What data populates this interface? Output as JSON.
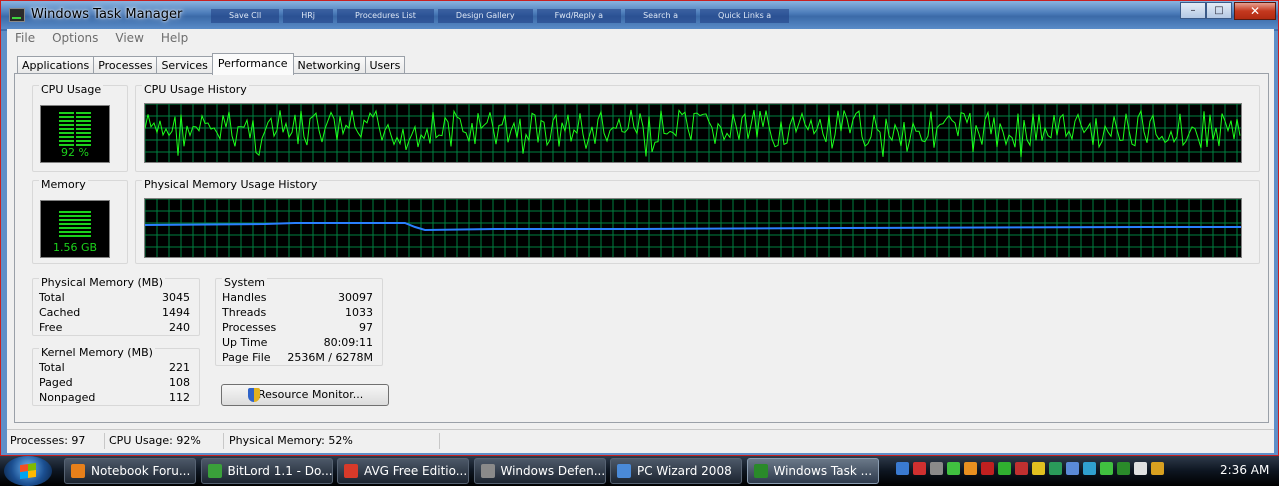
{
  "window": {
    "title": "Windows Task Manager",
    "background_tabs": [
      "Save Cll",
      "HRj",
      "Procedures List",
      "Design Gallery",
      "Fwd/Reply a",
      "Search a",
      "Quick Links a"
    ]
  },
  "menu": [
    "File",
    "Options",
    "View",
    "Help"
  ],
  "tabs": [
    {
      "label": "Applications"
    },
    {
      "label": "Processes"
    },
    {
      "label": "Services"
    },
    {
      "label": "Performance",
      "active": true
    },
    {
      "label": "Networking"
    },
    {
      "label": "Users"
    }
  ],
  "cpu_usage": {
    "label": "CPU Usage",
    "value": "92 %"
  },
  "cpu_history": {
    "label": "CPU Usage History"
  },
  "memory": {
    "label": "Memory",
    "value": "1.56 GB"
  },
  "memory_history": {
    "label": "Physical Memory Usage History"
  },
  "physical_memory": {
    "label": "Physical Memory (MB)",
    "rows": [
      {
        "k": "Total",
        "v": "3045"
      },
      {
        "k": "Cached",
        "v": "1494"
      },
      {
        "k": "Free",
        "v": "240"
      }
    ]
  },
  "kernel_memory": {
    "label": "Kernel Memory (MB)",
    "rows": [
      {
        "k": "Total",
        "v": "221"
      },
      {
        "k": "Paged",
        "v": "108"
      },
      {
        "k": "Nonpaged",
        "v": "112"
      }
    ]
  },
  "system": {
    "label": "System",
    "rows": [
      {
        "k": "Handles",
        "v": "30097"
      },
      {
        "k": "Threads",
        "v": "1033"
      },
      {
        "k": "Processes",
        "v": "97"
      },
      {
        "k": "Up Time",
        "v": "80:09:11"
      },
      {
        "k": "Page File",
        "v": "2536M / 6278M"
      }
    ]
  },
  "resource_monitor_button": "Resource Monitor...",
  "statusbar": {
    "processes": "Processes: 97",
    "cpu": "CPU Usage: 92%",
    "memory": "Physical Memory: 52%"
  },
  "taskbar": {
    "items": [
      {
        "label": "Notebook Foru...",
        "icon": "firefox-icon",
        "color": "#e8801a"
      },
      {
        "label": "BitLord 1.1 - Do...",
        "icon": "bitlord-icon",
        "color": "#3aa03a"
      },
      {
        "label": "AVG Free Editio...",
        "icon": "avg-icon",
        "color": "#d83a2a"
      },
      {
        "label": "Windows Defen...",
        "icon": "defender-icon",
        "color": "#8a8a8a"
      },
      {
        "label": "PC Wizard 2008",
        "icon": "pcwizard-icon",
        "color": "#4a8ad8"
      },
      {
        "label": "Windows Task ...",
        "icon": "taskmanager-icon",
        "color": "#2a8a2a",
        "active": true
      }
    ],
    "tray_colors": [
      "#3a7ad0",
      "#d03030",
      "#8a8a8a",
      "#40c040",
      "#e89020",
      "#c02020",
      "#30b030",
      "#c03030",
      "#e0c020",
      "#2a9a5a",
      "#5a8ad8",
      "#30a0d0",
      "#40c040",
      "#2a8a2a",
      "#e0e0e0",
      "#d8a020"
    ],
    "clock": "2:36 AM"
  }
}
